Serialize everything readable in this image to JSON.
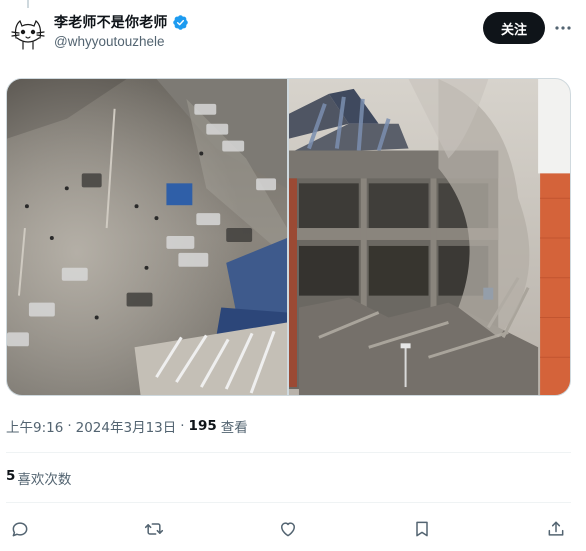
{
  "author": {
    "display_name": "李老师不是你老师",
    "handle": "@whyyoutouzhele",
    "verified": true
  },
  "header": {
    "follow_label": "关注",
    "more_icon": "more-horizontal-icon"
  },
  "media": {
    "photos": [
      "explosion-street-aerial-photo",
      "collapsed-building-photo"
    ]
  },
  "meta": {
    "time": "上午9:16",
    "separator": "·",
    "date": "2024年3月13日",
    "views_count": "195",
    "views_label": "查看"
  },
  "engagement": {
    "likes_count": "5",
    "likes_label": "喜欢次数"
  },
  "actions": [
    "reply-icon",
    "retweet-icon",
    "like-icon",
    "bookmark-icon",
    "share-icon"
  ],
  "colors": {
    "text_primary": "#0f1419",
    "text_secondary": "#536471",
    "verified_blue": "#1d9bf0",
    "divider": "#eff3f4"
  }
}
